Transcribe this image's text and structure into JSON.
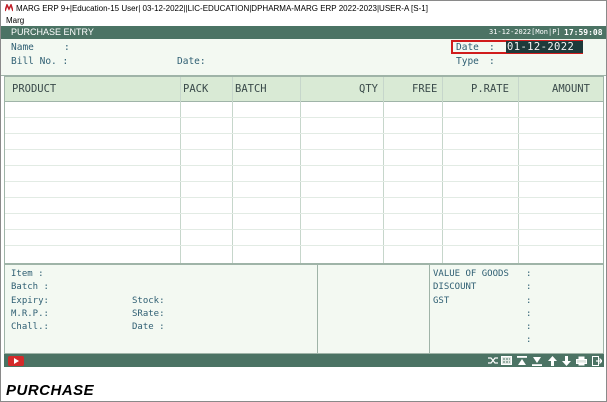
{
  "window": {
    "title": "MARG ERP 9+|Education-15 User| 03-12-2022||LIC-EDUCATION|DPHARMA-MARG ERP 2022-2023|USER-A [S-1]"
  },
  "menu": {
    "item": "Marg"
  },
  "header": {
    "title": "PURCHASE ENTRY",
    "system_date": "31-12-2022[Mon|P]",
    "time": "17:59:08"
  },
  "form": {
    "name_label": "Name",
    "name_colon": ":",
    "billno_label": "Bill No. :",
    "bill_date_label": "Date:",
    "date_label": "Date",
    "date_colon": ":",
    "date_value": "01-12-2022",
    "type_label": "Type",
    "type_colon": ":"
  },
  "grid": {
    "columns": [
      "PRODUCT",
      "PACK",
      "BATCH",
      "QTY",
      "FREE",
      "P.RATE",
      "AMOUNT"
    ],
    "rows": []
  },
  "details": {
    "item_label": "Item  :",
    "batch_label": "Batch :",
    "expiry_label": "Expiry:",
    "stock_label": "Stock:",
    "mrp_label": "M.R.P.:",
    "srate_label": "SRate:",
    "chall_label": "Chall.:",
    "date_label": "Date :"
  },
  "totals": {
    "value_of_goods_label": "VALUE OF GOODS",
    "discount_label": "DISCOUNT",
    "gst_label": "GST",
    "colon": ":"
  },
  "toolbar": {
    "icons": [
      "shuffle-icon",
      "calculator-icon",
      "first-icon",
      "last-icon",
      "up-arrow-icon",
      "down-arrow-icon",
      "print-icon",
      "exit-icon"
    ]
  },
  "footer": {
    "title": "PURCHASE"
  },
  "colors": {
    "header_bg": "#4b7364",
    "panel_bg": "#f3f9f2",
    "grid_header_bg": "#d9ead5",
    "highlight_border": "#d01c1c",
    "date_value_bg": "#1d3a3a"
  }
}
